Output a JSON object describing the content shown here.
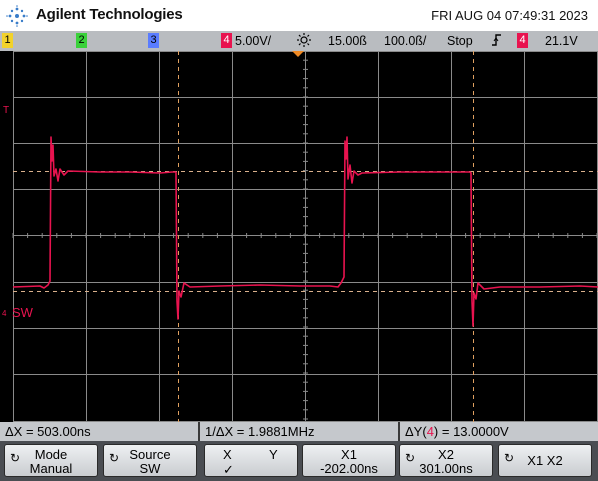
{
  "header": {
    "brand": "Agilent Technologies",
    "datetime": "FRI AUG 04 07:49:31 2023"
  },
  "settings_bar": {
    "channels": [
      {
        "label": "1",
        "color": "#f2d22a"
      },
      {
        "label": "2",
        "color": "#3ad13a"
      },
      {
        "label": "3",
        "color": "#5a7cff"
      },
      {
        "label": "4",
        "color": "#e8134f"
      }
    ],
    "ch4_scale": "5.00V/",
    "time_delay": "15.00ß",
    "time_base": "100.0ß/",
    "run_state": "Stop",
    "trigger_slope_icon": "rising-edge-icon",
    "trigger_source": "4",
    "trigger_level": "21.1V"
  },
  "markers": {
    "trigger_marker": "T",
    "channel_label": "4",
    "channel_name": "SW"
  },
  "measurements": {
    "delta_x": "ΔX = 503.00ns",
    "inverse_delta_x": "1/ΔX = 1.9881MHz",
    "delta_y_prefix": "ΔY(",
    "delta_y_channel": "4",
    "delta_y_suffix": ") = 13.0000V"
  },
  "softkeys": {
    "mode_title": "Mode",
    "mode_value": "Manual",
    "source_title": "Source",
    "source_value": "SW",
    "x_label": "X",
    "y_label": "Y",
    "x_check": "✓",
    "x1_title": "X1",
    "x1_value": "-202.00ns",
    "x2_title": "X2",
    "x2_value": "301.00ns",
    "x1x2_label": "X1 X2"
  },
  "colors": {
    "trace": "#e8134f",
    "grid": "#8a8a8a",
    "cursor_x": "#e0a060",
    "cursor_y": "#d9b08c"
  }
}
